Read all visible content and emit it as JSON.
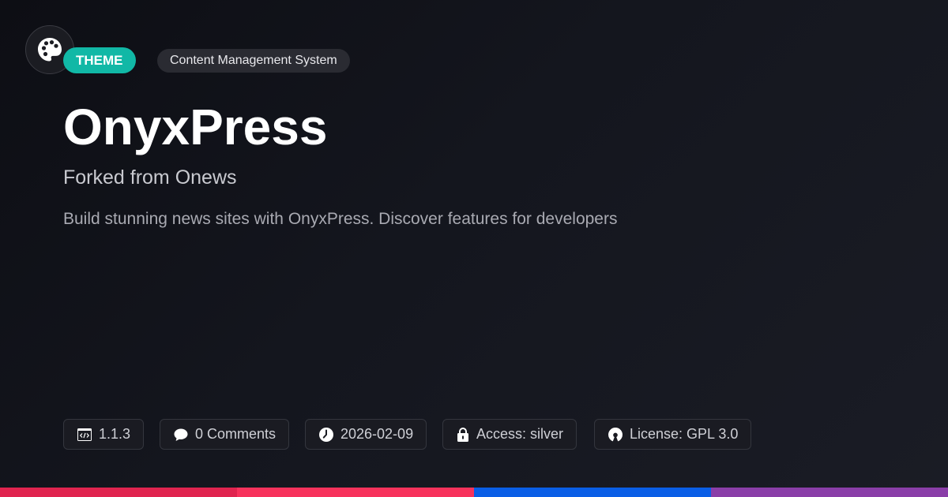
{
  "logo": {
    "icon": "palette-icon"
  },
  "tags": {
    "type": "THEME",
    "category": "Content Management System"
  },
  "title": "OnyxPress",
  "subtitle": "Forked from Onews",
  "description": "Build stunning news sites with OnyxPress. Discover features for developers",
  "meta": [
    {
      "icon": "code-window-icon",
      "label": "1.1.3"
    },
    {
      "icon": "comment-icon",
      "label": "0 Comments"
    },
    {
      "icon": "clock-icon",
      "label": "2026-02-09"
    },
    {
      "icon": "lock-icon",
      "label": "Access: silver"
    },
    {
      "icon": "open-source-icon",
      "label": "License: GPL 3.0"
    }
  ],
  "colors": {
    "accent": "#11b8a6",
    "bar": [
      "#e0244f",
      "#f7325c",
      "#0a5ee6",
      "#8a3ea8"
    ]
  }
}
